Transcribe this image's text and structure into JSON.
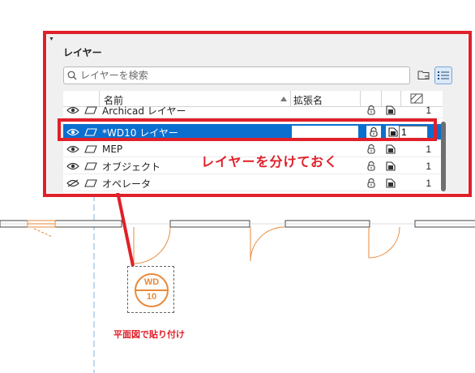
{
  "panel": {
    "title": "レイヤー",
    "search_placeholder": "レイヤーを検索"
  },
  "table": {
    "columns": {
      "name": "名前",
      "extension": "拡張名"
    },
    "rows": [
      {
        "name": "Archicad レイヤー",
        "pen": "1",
        "visible": true,
        "selected": false
      },
      {
        "name": "*WD10 レイヤー",
        "pen": "1",
        "visible": true,
        "selected": true
      },
      {
        "name": "MEP",
        "pen": "1",
        "visible": true,
        "selected": false
      },
      {
        "name": "オブジェクト",
        "pen": "1",
        "visible": true,
        "selected": false
      },
      {
        "name": "オペレータ",
        "pen": "1",
        "visible": false,
        "selected": false
      }
    ]
  },
  "annotations": {
    "callout": "レイヤーを分けておく",
    "caption": "平面図で貼り付け"
  },
  "door_tag": {
    "top": "WD",
    "bottom": "10"
  },
  "colors": {
    "highlight": "#e0202a",
    "selection": "#0b6fcf",
    "plan_orange": "#e88a3a",
    "grid_blue": "#7fb3e0"
  }
}
